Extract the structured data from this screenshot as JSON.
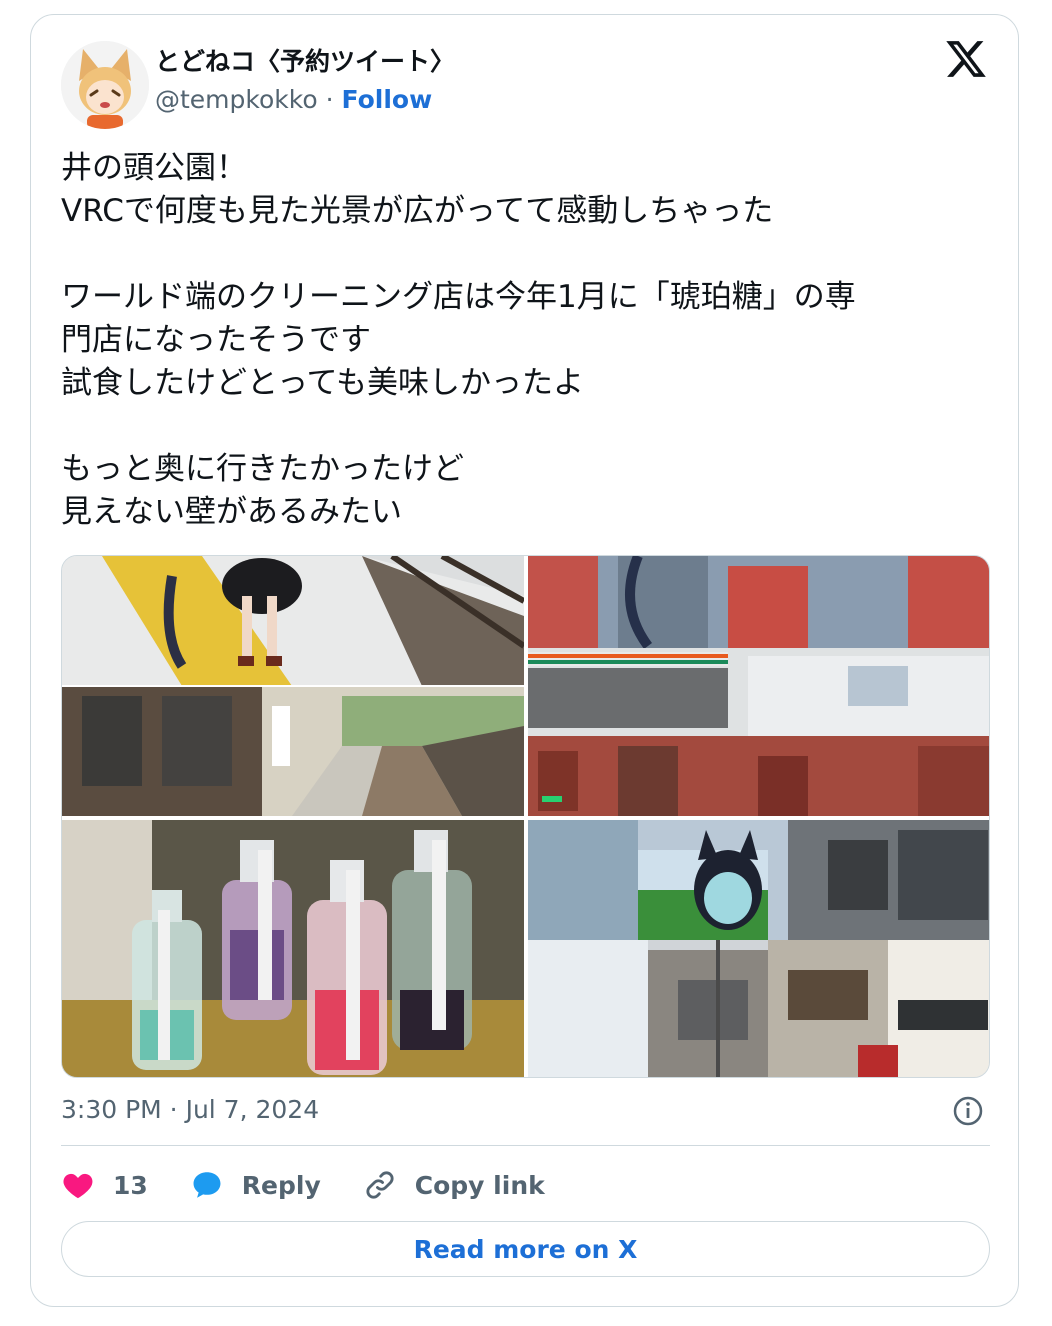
{
  "author": {
    "display_name": "とどねコ〈予約ツイート〉",
    "handle": "@tempkokko",
    "separator": "·",
    "follow_label": "Follow",
    "avatar_icon": "fox-girl-avatar"
  },
  "brand": {
    "logo_icon": "x-logo-icon"
  },
  "tweet": {
    "lines": [
      "井の頭公園！",
      "VRCで何度も見た光景が広がってて感動しちゃった",
      "",
      "ワールド端のクリーニング店は今年1月に「琥珀糖」の専",
      "門店になったそうです",
      "試食したけどとっても美味しかったよ",
      "",
      "もっと奥に行きたかったけど",
      "見えない壁があるみたい"
    ]
  },
  "media": {
    "photos": [
      {
        "icon": "train-platform-photo"
      },
      {
        "icon": "station-gate-photo"
      },
      {
        "icon": "candy-bottles-photo"
      },
      {
        "icon": "street-photo"
      }
    ]
  },
  "meta": {
    "timestamp": "3:30 PM · Jul 7, 2024"
  },
  "actions": {
    "like_count": "13",
    "reply_label": "Reply",
    "copy_link_label": "Copy link"
  },
  "read_more_label": "Read more on X",
  "colors": {
    "accent": "#1d6fd6",
    "heart": "#f91880",
    "reply_bubble": "#1d9bf0",
    "muted": "#536471",
    "border": "#cfd9de"
  }
}
